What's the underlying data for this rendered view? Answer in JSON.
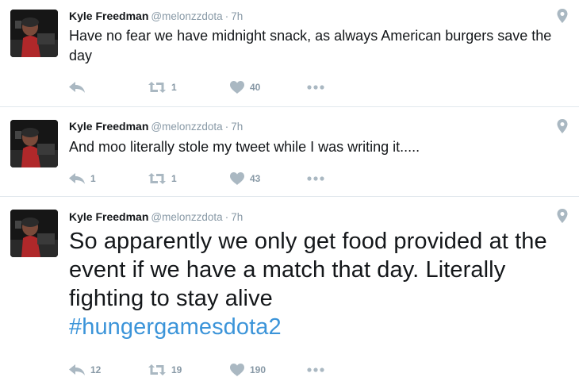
{
  "tweets": [
    {
      "author": "Kyle Freedman",
      "handle": "@melonzzdota",
      "separator": "·",
      "time": "7h",
      "text": "Have no fear we have midnight snack, as always American burgers save the day",
      "hashtag": "",
      "replies": "",
      "retweets": "1",
      "likes": "40"
    },
    {
      "author": "Kyle Freedman",
      "handle": "@melonzzdota",
      "separator": "·",
      "time": "7h",
      "text": "And moo literally stole my tweet while I was writing it.....",
      "hashtag": "",
      "replies": "1",
      "retweets": "1",
      "likes": "43"
    },
    {
      "author": "Kyle Freedman",
      "handle": "@melonzzdota",
      "separator": "·",
      "time": "7h",
      "text": "So apparently we only get food provided at the event if we have a match that day. Literally fighting to stay alive",
      "hashtag": "#hungergamesdota2",
      "replies": "12",
      "retweets": "19",
      "likes": "190"
    }
  ],
  "icons": {
    "reply": "reply-icon",
    "retweet": "retweet-icon",
    "like": "heart-icon",
    "more": "more-icon",
    "location": "location-pin-icon"
  },
  "colors": {
    "icon": "#aab8c2",
    "meta": "#8899a6",
    "hashtag": "#3b94d9",
    "divider": "#e1e8ed"
  }
}
